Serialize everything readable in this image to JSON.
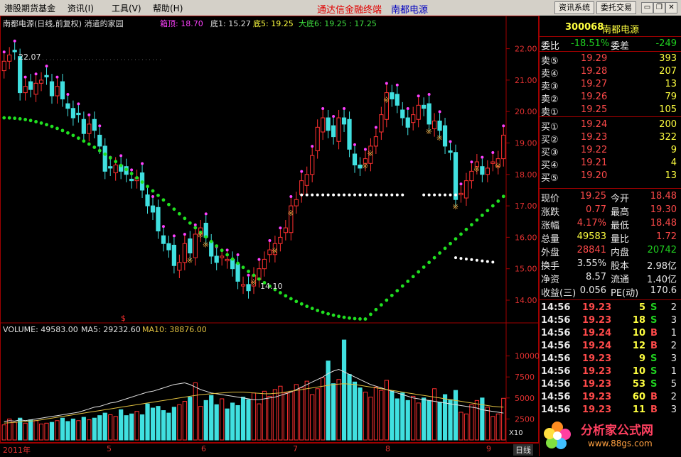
{
  "menu": {
    "items": [
      "港股期货基金",
      "资讯(I)",
      "工具(V)",
      "帮助(H)"
    ],
    "title": "通达信金融终端",
    "stock_name": "南都电源",
    "btn_info": "资讯系统",
    "btn_trade": "委托交易"
  },
  "chart_header": {
    "title": "南都电源(日线,前复权) 消遣的家园",
    "box_top": "箱顶: 18.70",
    "bottom1": "底1: 15.27",
    "bottom5": "底5: 19.25",
    "big_bottom": "大底6: 19.25 : 17.25"
  },
  "volume_header": {
    "volume": "VOLUME: 49583.00",
    "ma5": "MA5: 29232.60",
    "ma10": "MA10: 38876.00"
  },
  "annotations": {
    "high": "22.07",
    "low": "14.10",
    "x10": "X10"
  },
  "bottom_axis": {
    "year": "2011年",
    "m5": "5",
    "m6": "6",
    "m7": "7",
    "m8": "8",
    "m9": "9",
    "period": "日线"
  },
  "chart_data": [
    {
      "type": "candlestick",
      "price_axis": [
        22.0,
        21.0,
        20.0,
        19.0,
        18.0,
        17.0,
        16.0,
        15.0,
        14.0
      ],
      "ylim": [
        13.3,
        22.6
      ],
      "close": [
        21.6,
        21.8,
        21.9,
        20.6,
        20.8,
        20.7,
        20.9,
        21.0,
        21.1,
        20.5,
        20.8,
        20.4,
        20.1,
        19.8,
        19.9,
        19.3,
        19.6,
        19.4,
        18.9,
        18.1,
        18.2,
        18.3,
        18.1,
        18.0,
        17.8,
        17.9,
        17.5,
        17.0,
        16.8,
        16.2,
        15.8,
        15.6,
        15.1,
        15.2,
        15.8,
        15.5,
        16.1,
        16.3,
        16.0,
        15.4,
        15.2,
        15.4,
        15.3,
        15.0,
        14.6,
        14.5,
        14.3,
        14.8,
        15.0,
        15.3,
        15.6,
        15.8,
        16.0,
        16.3,
        17.0,
        17.2,
        17.8,
        18.0,
        18.6,
        19.5,
        19.8,
        19.4,
        19.2,
        19.8,
        19.6,
        18.8,
        18.3,
        18.2,
        18.5,
        18.9,
        19.2,
        19.9,
        20.6,
        20.4,
        20.2,
        19.8,
        19.5,
        19.9,
        20.2,
        20.1,
        19.6,
        19.7,
        19.4,
        18.9,
        18.7,
        17.2,
        17.4,
        17.8,
        18.1,
        18.4,
        18.0,
        18.2,
        18.4,
        18.5,
        19.25
      ],
      "volume_axis": [
        10000,
        7500,
        5000,
        2500
      ],
      "volume": [
        1800,
        2500,
        2100,
        2600,
        2000,
        2400,
        2300,
        1900,
        2000,
        2100,
        2300,
        2600,
        2200,
        2500,
        2300,
        2700,
        2400,
        2600,
        2900,
        3200,
        3000,
        2800,
        3600,
        2900,
        3100,
        3400,
        3000,
        4300,
        3800,
        4000,
        3500,
        3200,
        3900,
        4200,
        4600,
        5100,
        6800,
        4000,
        4700,
        5300,
        4200,
        4900,
        3700,
        4400,
        4100,
        5100,
        4800,
        5600,
        4300,
        5800,
        5200,
        6000,
        6400,
        5600,
        5800,
        6600,
        6200,
        7000,
        5400,
        6100,
        7400,
        9400,
        6700,
        7200,
        11900,
        7800,
        6900,
        6200,
        5700,
        5100,
        6300,
        5900,
        7100,
        5800,
        4900,
        5600,
        4700,
        5200,
        4400,
        5000,
        4700,
        6100,
        4500,
        5400,
        4800,
        5900,
        3300,
        3100,
        4200,
        4700,
        5000,
        3900,
        2800,
        3100,
        4958
      ],
      "ma5": [
        2200,
        2300,
        2250,
        2400,
        2300,
        2400,
        2500,
        2600,
        2700,
        2800,
        2900,
        3000,
        3100,
        3200,
        3300,
        3500,
        3700,
        3900,
        4000,
        4200,
        4400,
        4500,
        4700,
        4900,
        5100,
        5300,
        5500,
        5700,
        5800,
        6000,
        6200,
        6400,
        6600,
        6700,
        6800,
        6600,
        6300,
        6000,
        5800,
        5600,
        5500,
        5400,
        5300,
        5200,
        5100,
        5000,
        4900,
        4800,
        4800,
        4900,
        5000,
        5100,
        5300,
        5500,
        5700,
        6000,
        6300,
        6600,
        6900,
        7200,
        7500,
        7900,
        8200,
        8400,
        8100,
        7800,
        7500,
        7200,
        6900,
        6600,
        6400,
        6200,
        6000,
        5800,
        5600,
        5400,
        5200,
        5000,
        4900,
        4800,
        4700,
        4600,
        4500,
        4400,
        4300,
        4200,
        4100,
        4000,
        3900,
        3800,
        3600,
        3500,
        3400,
        3300,
        3200
      ],
      "ma10": [
        2000,
        2050,
        2100,
        2150,
        2200,
        2250,
        2300,
        2400,
        2500,
        2600,
        2700,
        2800,
        2900,
        3000,
        3100,
        3200,
        3300,
        3400,
        3500,
        3600,
        3700,
        3800,
        3900,
        4000,
        4100,
        4200,
        4300,
        4400,
        4500,
        4600,
        4700,
        4800,
        4900,
        5000,
        5100,
        5200,
        5300,
        5400,
        5450,
        5500,
        5550,
        5600,
        5650,
        5700,
        5700,
        5700,
        5650,
        5600,
        5550,
        5500,
        5500,
        5550,
        5600,
        5700,
        5800,
        5900,
        6000,
        6100,
        6200,
        6300,
        6400,
        6500,
        6600,
        6650,
        6700,
        6650,
        6600,
        6500,
        6400,
        6300,
        6200,
        6100,
        6000,
        5900,
        5800,
        5700,
        5600,
        5500,
        5400,
        5300,
        5200,
        5100,
        5000,
        4900,
        4800,
        4700,
        4600,
        4500,
        4400,
        4300,
        4200,
        4100,
        4000,
        3950,
        3900
      ]
    }
  ],
  "quote": {
    "code": "300068",
    "name": "南都电源",
    "weibi_label": "委比",
    "weibi": "-18.51%",
    "weicha_label": "委差",
    "weicha": "-249",
    "sell": [
      {
        "label": "卖⑤",
        "price": "19.29",
        "vol": "393"
      },
      {
        "label": "卖④",
        "price": "19.28",
        "vol": "207"
      },
      {
        "label": "卖③",
        "price": "19.27",
        "vol": "13"
      },
      {
        "label": "卖②",
        "price": "19.26",
        "vol": "79"
      },
      {
        "label": "卖①",
        "price": "19.25",
        "vol": "105"
      }
    ],
    "buy": [
      {
        "label": "买①",
        "price": "19.24",
        "vol": "200"
      },
      {
        "label": "买②",
        "price": "19.23",
        "vol": "322"
      },
      {
        "label": "买③",
        "price": "19.22",
        "vol": "9"
      },
      {
        "label": "买④",
        "price": "19.21",
        "vol": "4"
      },
      {
        "label": "买⑤",
        "price": "19.20",
        "vol": "13"
      }
    ],
    "stats": [
      {
        "l1": "现价",
        "v1": "19.25",
        "l2": "今开",
        "v2": "18.48",
        "c1": "red",
        "c2": "red"
      },
      {
        "l1": "涨跌",
        "v1": "0.77",
        "l2": "最高",
        "v2": "19.30",
        "c1": "red",
        "c2": "red"
      },
      {
        "l1": "涨幅",
        "v1": "4.17%",
        "l2": "最低",
        "v2": "18.48",
        "c1": "red",
        "c2": "red"
      },
      {
        "l1": "总量",
        "v1": "49583",
        "l2": "量比",
        "v2": "1.72",
        "c1": "yel",
        "c2": "red"
      },
      {
        "l1": "外盘",
        "v1": "28841",
        "l2": "内盘",
        "v2": "20742",
        "c1": "red",
        "c2": "grn"
      },
      {
        "l1": "换手",
        "v1": "3.55%",
        "l2": "股本",
        "v2": "2.98亿",
        "c1": "wht",
        "c2": "wht"
      },
      {
        "l1": "净资",
        "v1": "8.57",
        "l2": "流通",
        "v2": "1.40亿",
        "c1": "wht",
        "c2": "wht"
      },
      {
        "l1": "收益(三)",
        "v1": "0.056",
        "l2": "PE(动)",
        "v2": "170.6",
        "c1": "wht",
        "c2": "wht"
      }
    ],
    "ticks": [
      {
        "time": "14:56",
        "price": "19.23",
        "vol": "5",
        "side": "S",
        "n": "2"
      },
      {
        "time": "14:56",
        "price": "19.23",
        "vol": "18",
        "side": "S",
        "n": "3"
      },
      {
        "time": "14:56",
        "price": "19.24",
        "vol": "10",
        "side": "B",
        "n": "1"
      },
      {
        "time": "14:56",
        "price": "19.24",
        "vol": "12",
        "side": "B",
        "n": "2"
      },
      {
        "time": "14:56",
        "price": "19.23",
        "vol": "9",
        "side": "S",
        "n": "3"
      },
      {
        "time": "14:56",
        "price": "19.23",
        "vol": "10",
        "side": "S",
        "n": "1"
      },
      {
        "time": "14:56",
        "price": "19.23",
        "vol": "53",
        "side": "S",
        "n": "5"
      },
      {
        "time": "14:56",
        "price": "19.23",
        "vol": "60",
        "side": "B",
        "n": "2"
      },
      {
        "time": "14:56",
        "price": "19.23",
        "vol": "11",
        "side": "B",
        "n": "3"
      }
    ]
  },
  "watermark": {
    "text": "分析家公式网",
    "url": "www.88gs.com"
  },
  "colors": {
    "up": "#ff3030",
    "down": "#40e0e0",
    "ma_green": "#20e020",
    "ma5": "#e0e0e0",
    "ma10": "#e0c040",
    "frame": "#a00000",
    "signal": "#e0a040"
  }
}
